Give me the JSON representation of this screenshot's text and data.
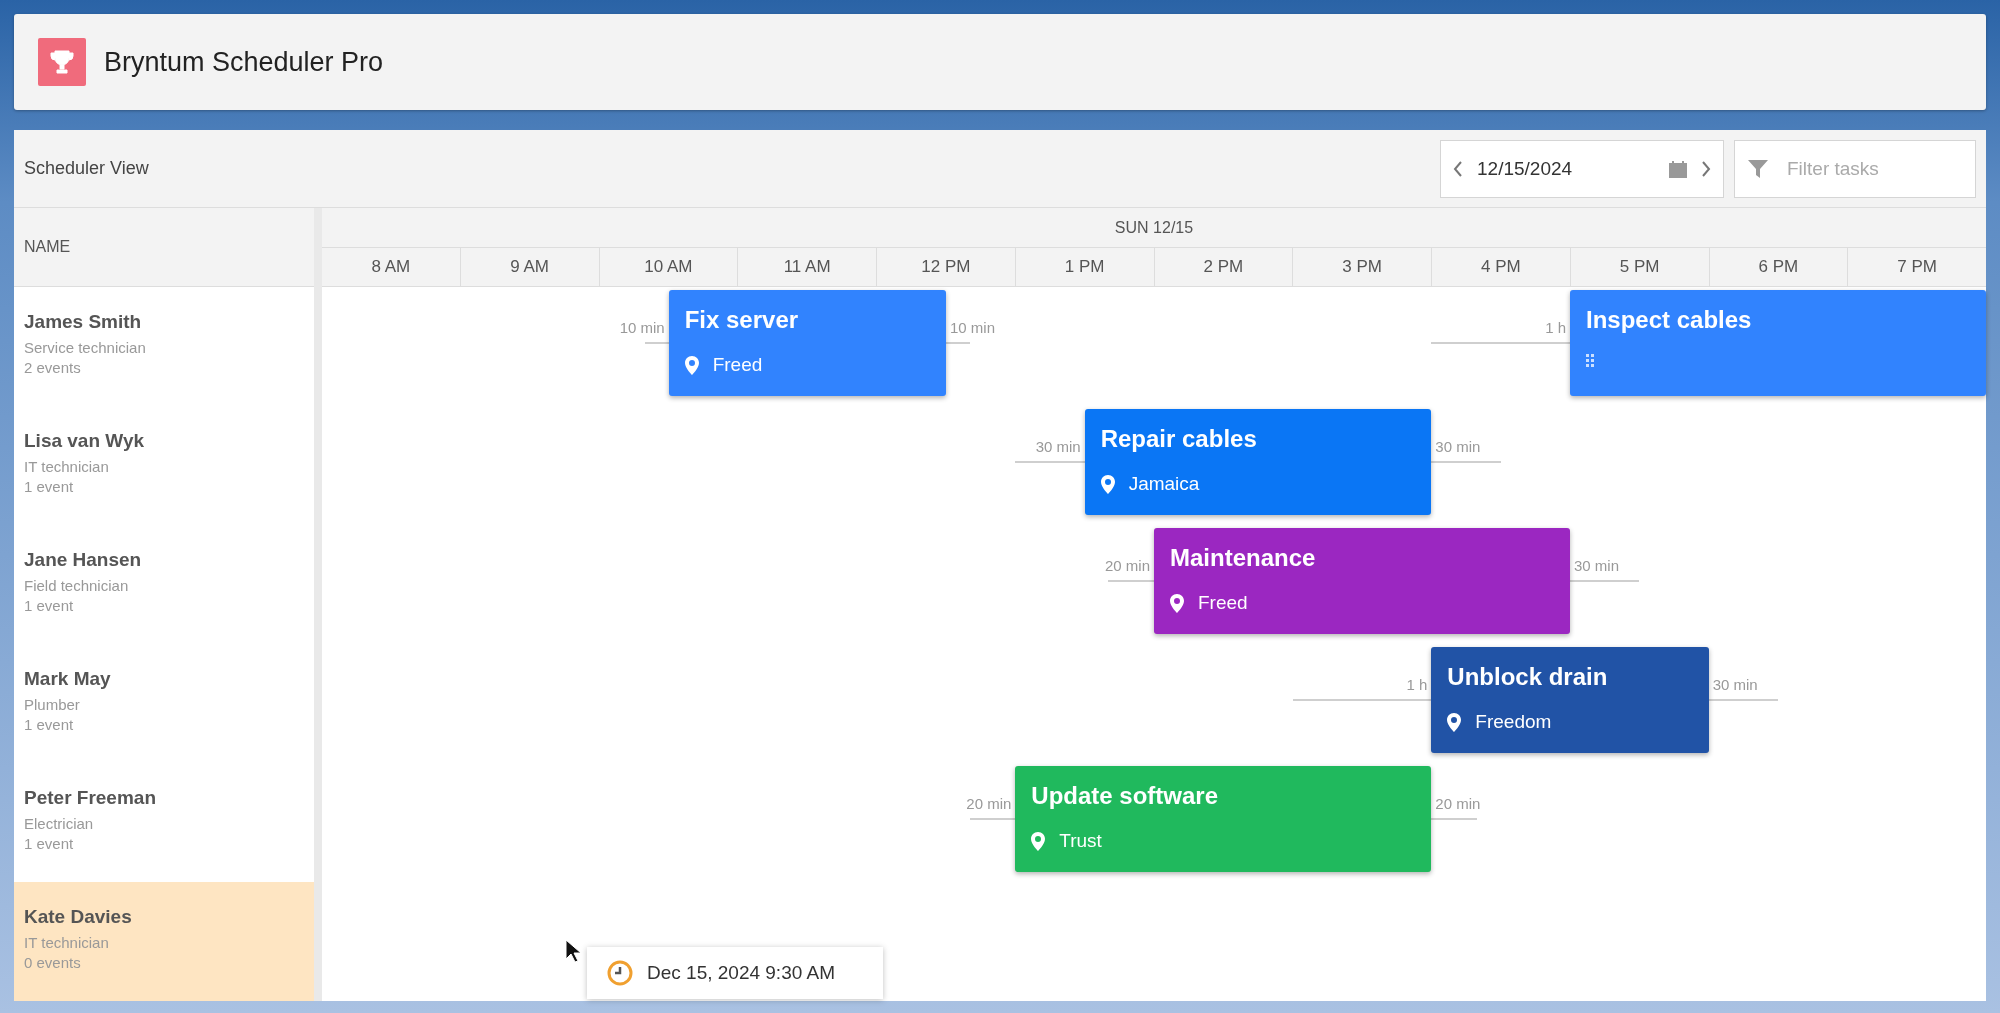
{
  "app": {
    "title": "Bryntum Scheduler Pro"
  },
  "toolbar": {
    "title": "Scheduler View",
    "date": "12/15/2024",
    "filter": {
      "placeholder": "Filter tasks"
    }
  },
  "grid": {
    "name_column": "NAME",
    "day": "SUN 12/15",
    "hours": [
      "8 AM",
      "9 AM",
      "10 AM",
      "11 AM",
      "12 PM",
      "1 PM",
      "2 PM",
      "3 PM",
      "4 PM",
      "5 PM",
      "6 PM",
      "7 PM"
    ]
  },
  "resources": [
    {
      "name": "James Smith",
      "role": "Service technician",
      "count": "2 events",
      "selected": false,
      "events": [
        {
          "kind": "location",
          "title": "Fix server",
          "location": "Freed",
          "color": "#3183fe",
          "before": "10 min",
          "after": "10 min"
        },
        {
          "kind": "handle",
          "title": "Inspect cables",
          "color": "#3183fe",
          "before": "1 h"
        }
      ]
    },
    {
      "name": "Lisa van Wyk",
      "role": "IT technician",
      "count": "1 event",
      "selected": false,
      "events": [
        {
          "kind": "location",
          "title": "Repair cables",
          "location": "Jamaica",
          "color": "#0a76f5",
          "before": "30 min",
          "after": "30 min"
        }
      ]
    },
    {
      "name": "Jane Hansen",
      "role": "Field technician",
      "count": "1 event",
      "selected": false,
      "events": [
        {
          "kind": "location",
          "title": "Maintenance",
          "location": "Freed",
          "color": "#9b27c1",
          "before": "20 min",
          "after": "30 min"
        }
      ]
    },
    {
      "name": "Mark May",
      "role": "Plumber",
      "count": "1 event",
      "selected": false,
      "events": [
        {
          "kind": "location",
          "title": "Unblock drain",
          "location": "Freedom",
          "color": "#2153a6",
          "before": "1 h",
          "after": "30 min"
        }
      ]
    },
    {
      "name": "Peter Freeman",
      "role": "Electrician",
      "count": "1 event",
      "selected": false,
      "events": [
        {
          "kind": "location",
          "title": "Update software",
          "location": "Trust",
          "color": "#20b95d",
          "before": "20 min",
          "after": "20 min"
        }
      ]
    },
    {
      "name": "Kate Davies",
      "role": "IT technician",
      "count": "0 events",
      "selected": true
    }
  ],
  "tooltip": {
    "text": "Dec 15, 2024 9:30 AM"
  }
}
